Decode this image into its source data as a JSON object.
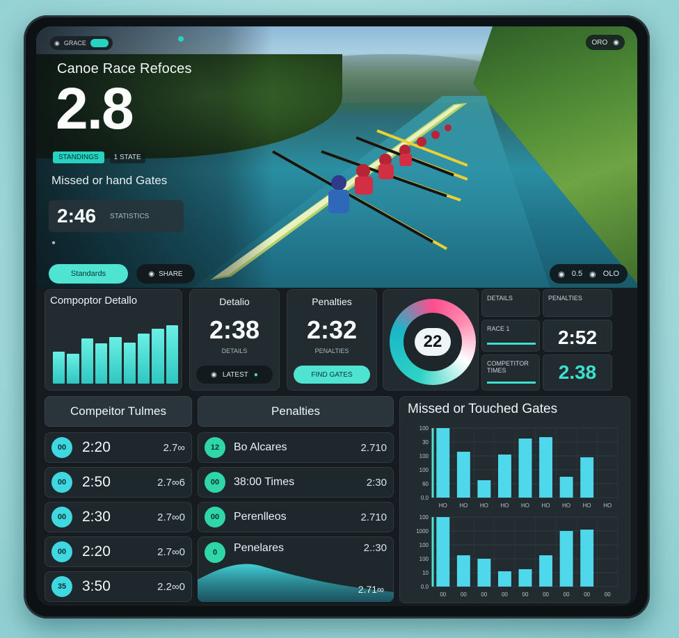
{
  "hero": {
    "top_chip": "GRACE",
    "top_right_label": "ORO",
    "title": "Canoe Race Refoces",
    "value": "2.8",
    "tag_primary": "STANDINGS",
    "tag_secondary": "1 STATE",
    "subtitle": "Missed or hand Gates",
    "box_value": "2:46",
    "box_label": "STATISTICS",
    "small_note": "●",
    "button_primary": "Standards",
    "button_secondary": "SHARE",
    "ctrl_left": "◉",
    "ctrl_mid": "0.5",
    "ctrl_right": "OLO"
  },
  "competitor_details": {
    "title": "Compoptor Detallo",
    "bars": [
      {
        "label": "",
        "value": 48
      },
      {
        "label": "",
        "value": 45
      },
      {
        "label": "",
        "value": 68
      },
      {
        "label": "",
        "value": 60
      },
      {
        "label": "",
        "value": 70
      },
      {
        "label": "",
        "value": 61
      },
      {
        "label": "",
        "value": 75
      },
      {
        "label": "",
        "value": 82
      },
      {
        "label": "",
        "value": 88
      }
    ]
  },
  "detail_card": {
    "title": "Detalio",
    "value": "2:38",
    "caption": "DETAILS",
    "button": "LATEST"
  },
  "penalties_card": {
    "title": "Penalties",
    "value": "2:32",
    "caption": "PENALTIES",
    "button": "FIND GATES"
  },
  "ring": {
    "value": "22"
  },
  "stats": [
    {
      "label": "DETAILS",
      "value": ""
    },
    {
      "label": "PENALTIES",
      "value": ""
    },
    {
      "label": "RACE 1",
      "value": "2:52"
    },
    {
      "label": "COMPETITOR TIMES",
      "value": "2.38"
    }
  ],
  "competitor_times": {
    "title": "Compeitor Tulmes",
    "rows": [
      {
        "icon": "00",
        "time": "2:20",
        "split": "2.7∞"
      },
      {
        "icon": "00",
        "time": "2:50",
        "split": "2.7∞6"
      },
      {
        "icon": "00",
        "time": "2:30",
        "split": "2.7∞0"
      },
      {
        "icon": "00",
        "time": "2:20",
        "split": "2.7∞0"
      },
      {
        "icon": "35",
        "time": "3:50",
        "split": "2.2∞0"
      }
    ]
  },
  "penalties_list": {
    "title": "Penalties",
    "rows": [
      {
        "icon": "12",
        "text": "Bo Alcares",
        "value": "2.710"
      },
      {
        "icon": "00",
        "text": "38:00 Times",
        "value": "2:30"
      },
      {
        "icon": "00",
        "text": "Perenlleos",
        "value": "2.710"
      },
      {
        "icon": "0",
        "text": "Penelares",
        "value": "2.:30"
      },
      {
        "icon": "",
        "text": "",
        "value": "2.71∞"
      }
    ]
  },
  "gates_chart": {
    "chart_data": {
      "type": "bar",
      "title": "Missed or Touched Gates",
      "charts": [
        {
          "categories": [
            "HO",
            "HO",
            "HO",
            "HO",
            "HO",
            "HO",
            "HO",
            "HO",
            "HO"
          ],
          "values": [
            100,
            66,
            25,
            62,
            85,
            87,
            30,
            58
          ],
          "ylabels": [
            "100",
            "30",
            "100",
            "100",
            "60",
            "0.0"
          ]
        },
        {
          "categories": [
            "00",
            "00",
            "00",
            "00",
            "00",
            "00",
            "00",
            "00",
            "00"
          ],
          "values": [
            100,
            45,
            40,
            22,
            25,
            45,
            80,
            82
          ],
          "ylabels": [
            "100",
            "1000",
            "100",
            "100",
            "10",
            "0.0"
          ]
        }
      ]
    }
  }
}
